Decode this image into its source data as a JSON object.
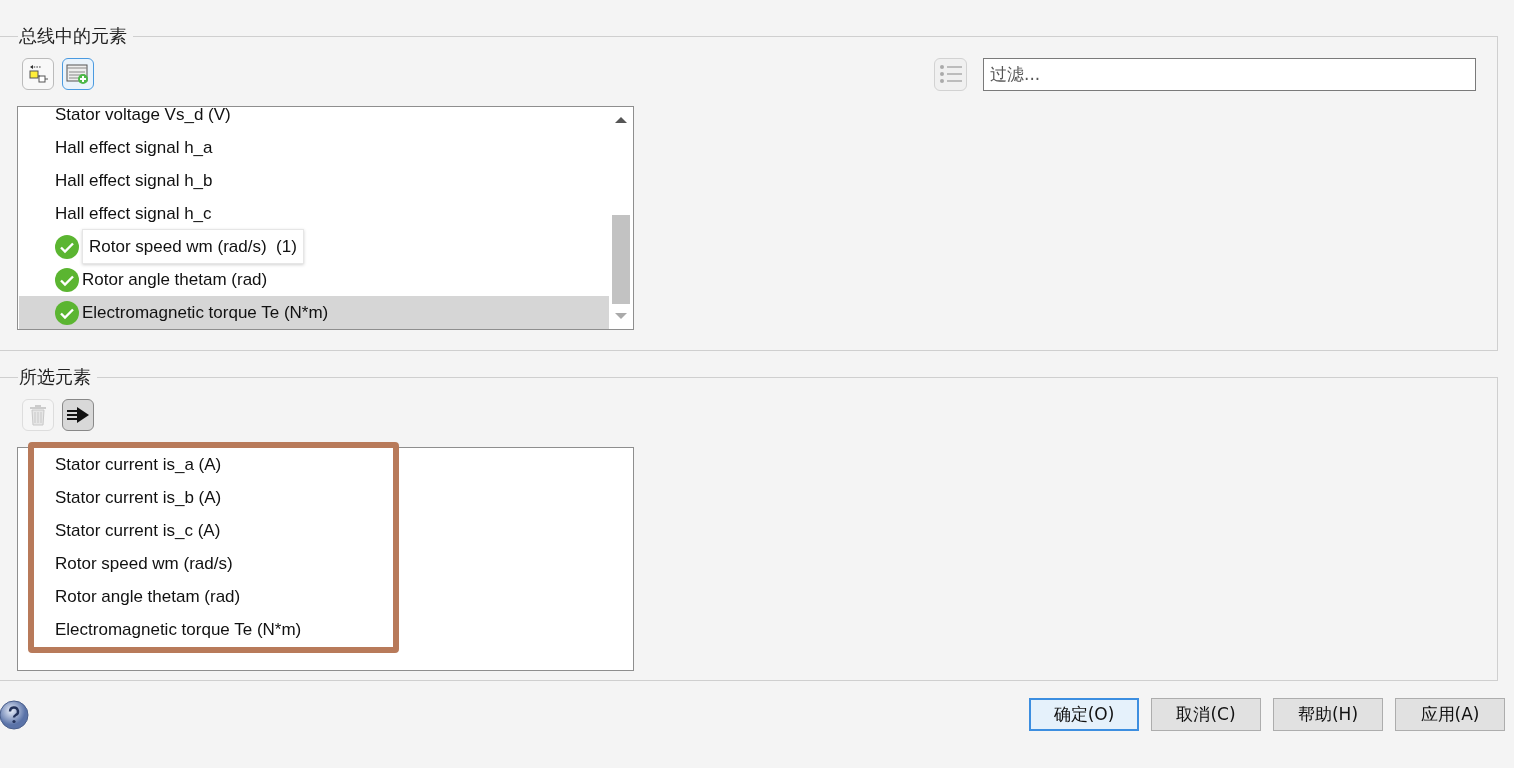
{
  "bus_elements": {
    "title": "总线中的元素",
    "toolbar": [
      {
        "kind": "select-block",
        "focused": false
      },
      {
        "kind": "insert",
        "focused": true
      }
    ],
    "filter": {
      "placeholder": "过滤..."
    },
    "items": [
      {
        "label": "Stator voltage Vs_d (V)",
        "checked": false,
        "selected": false
      },
      {
        "label": "Hall effect signal h_a",
        "checked": false,
        "selected": false
      },
      {
        "label": "Hall effect signal h_b",
        "checked": false,
        "selected": false
      },
      {
        "label": "Hall effect signal h_c",
        "checked": false,
        "selected": false
      },
      {
        "checked": true,
        "selected": false
      },
      {
        "label": "Rotor angle thetam (rad)",
        "checked": true,
        "selected": false
      },
      {
        "label": "Electromagnetic torque Te (N*m)",
        "checked": true,
        "selected": true
      }
    ],
    "tooltip": {
      "text": "Rotor speed wm (rad/s)  (1)"
    }
  },
  "selected_elements": {
    "title": "所选元素",
    "toolbar": [
      {
        "kind": "delete",
        "disabled": true
      },
      {
        "kind": "move",
        "disabled": false
      }
    ],
    "highlighted": true,
    "items": [
      "Stator current is_a (A)",
      "Stator current is_b (A)",
      "Stator current is_c (A)",
      "Rotor speed wm (rad/s)",
      "Rotor angle thetam (rad)",
      "Electromagnetic torque Te (N*m)"
    ]
  },
  "buttons": [
    {
      "label": "确定(O)",
      "default": true
    },
    {
      "label": "取消(C)",
      "default": false
    },
    {
      "label": "帮助(H)",
      "default": false
    },
    {
      "label": "应用(A)",
      "default": false
    }
  ]
}
